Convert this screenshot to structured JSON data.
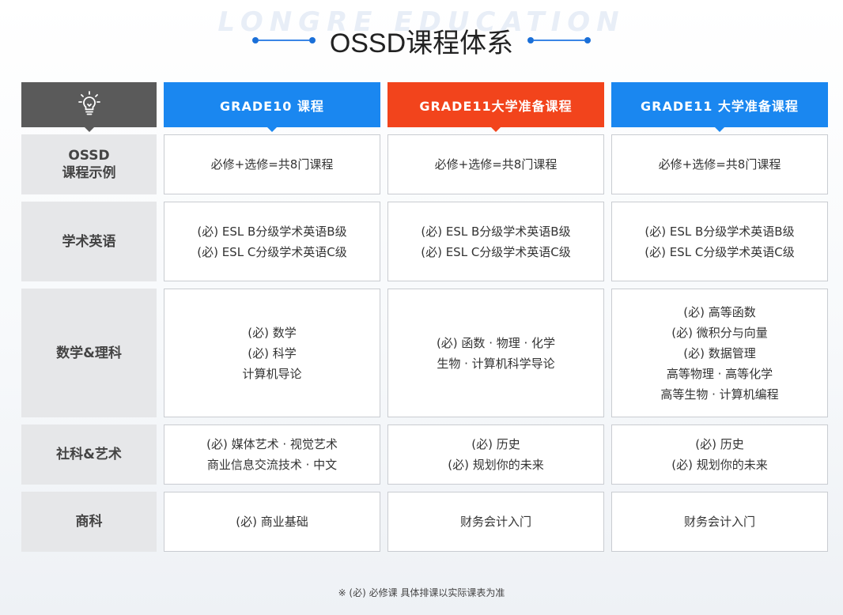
{
  "header": {
    "watermark": "LONGRE EDUCATION",
    "title": "OSSD课程体系"
  },
  "columns": [
    {
      "label": "GRADE10 课程",
      "color": "#1a87f0"
    },
    {
      "label": "GRADE11大学准备课程",
      "color": "#f2441c"
    },
    {
      "label": "GRADE11 大学准备课程",
      "color": "#1a87f0"
    }
  ],
  "rows": [
    {
      "label": "OSSD\n课程示例",
      "cells": [
        [
          "必修+选修=共8门课程"
        ],
        [
          "必修+选修=共8门课程"
        ],
        [
          "必修+选修=共8门课程"
        ]
      ]
    },
    {
      "label": "学术英语",
      "cells": [
        [
          "(必) ESL B分级学术英语B级",
          "(必) ESL C分级学术英语C级"
        ],
        [
          "(必) ESL B分级学术英语B级",
          "(必) ESL C分级学术英语C级"
        ],
        [
          "(必) ESL B分级学术英语B级",
          "(必) ESL C分级学术英语C级"
        ]
      ]
    },
    {
      "label": "数学&理科",
      "cells": [
        [
          "(必) 数学",
          "(必) 科学",
          "计算机导论"
        ],
        [
          "(必) 函数 · 物理 · 化学",
          "生物 · 计算机科学导论"
        ],
        [
          "(必) 高等函数",
          "(必) 微积分与向量",
          "(必) 数据管理",
          "高等物理 · 高等化学",
          "高等生物 · 计算机编程"
        ]
      ]
    },
    {
      "label": "社科&艺术",
      "cells": [
        [
          "(必) 媒体艺术 · 视觉艺术",
          "商业信息交流技术 · 中文"
        ],
        [
          "(必) 历史",
          "(必) 规划你的未来"
        ],
        [
          "(必) 历史",
          "(必) 规划你的未来"
        ]
      ]
    },
    {
      "label": "商科",
      "cells": [
        [
          "(必) 商业基础"
        ],
        [
          "财务会计入门"
        ],
        [
          "财务会计入门"
        ]
      ]
    }
  ],
  "footnote": "※ (必) 必修课 具体排课以实际课表为准",
  "icons": {
    "corner": "lightbulb-icon"
  }
}
